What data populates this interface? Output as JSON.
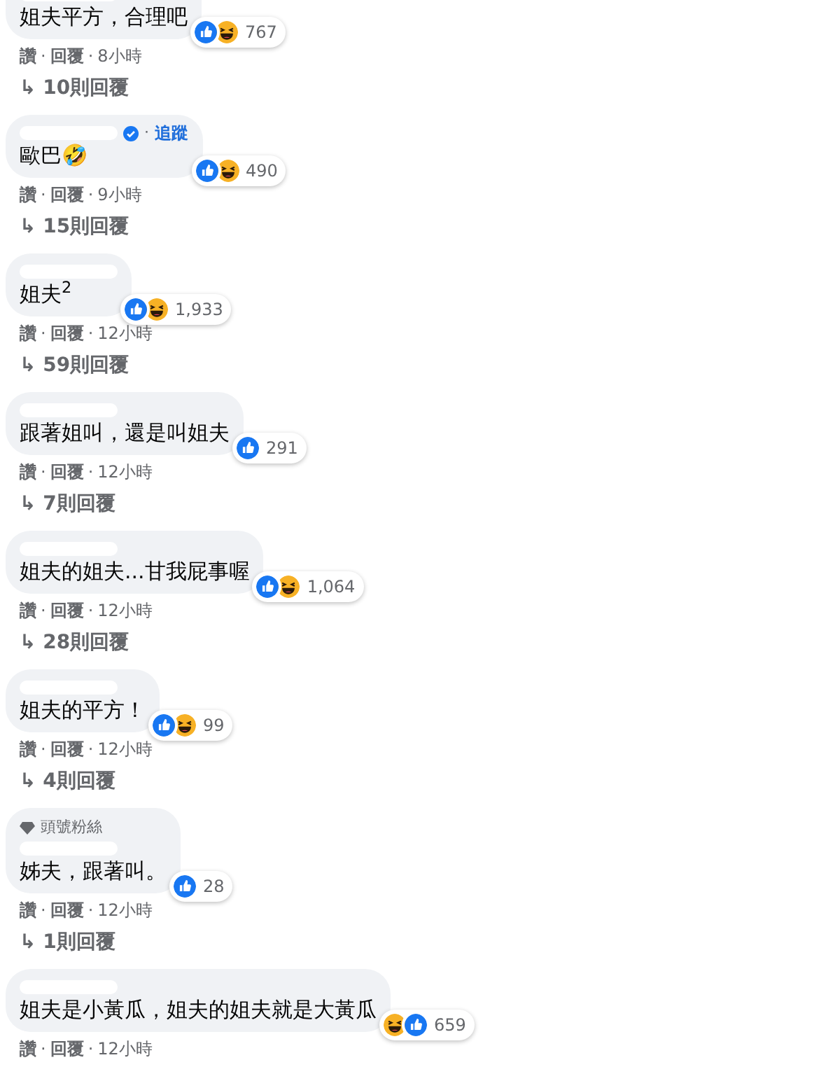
{
  "comments": [
    {
      "verified": false,
      "text": "姐夫平方，合理吧",
      "reactions": [
        {
          "kind": "like"
        },
        {
          "kind": "haha"
        }
      ],
      "count": "767",
      "actions": [
        "讚",
        "回覆",
        "8小時"
      ],
      "replies": "10則回覆"
    },
    {
      "verified": true,
      "follow": "追蹤",
      "text": "歐巴🤣",
      "reactions": [
        {
          "kind": "like"
        },
        {
          "kind": "haha"
        }
      ],
      "count": "490",
      "actions": [
        "讚",
        "回覆",
        "9小時"
      ],
      "replies": "15則回覆"
    },
    {
      "verified": false,
      "text": "姐夫$^{2}$",
      "reactions": [
        {
          "kind": "like"
        },
        {
          "kind": "haha"
        }
      ],
      "count": "1,933",
      "actions": [
        "讚",
        "回覆",
        "12小時"
      ],
      "replies": "59則回覆"
    },
    {
      "verified": false,
      "text": "跟著姐叫，還是叫姐夫",
      "reactions": [
        {
          "kind": "like"
        }
      ],
      "count": "291",
      "actions": [
        "讚",
        "回覆",
        "12小時"
      ],
      "replies": "7則回覆"
    },
    {
      "verified": false,
      "text": "姐夫的姐夫...甘我屁事喔",
      "reactions": [
        {
          "kind": "like"
        },
        {
          "kind": "haha"
        }
      ],
      "count": "1,064",
      "actions": [
        "讚",
        "回覆",
        "12小時"
      ],
      "replies": "28則回覆"
    },
    {
      "verified": false,
      "text": "姐夫的平方！",
      "reactions": [
        {
          "kind": "like"
        },
        {
          "kind": "haha"
        }
      ],
      "count": "99",
      "actions": [
        "讚",
        "回覆",
        "12小時"
      ],
      "replies": "4則回覆"
    },
    {
      "verified": false,
      "badge": "頭號粉絲",
      "text": "姊夫，跟著叫。",
      "reactions": [
        {
          "kind": "like"
        }
      ],
      "count": "28",
      "actions": [
        "讚",
        "回覆",
        "12小時"
      ],
      "replies": "1則回覆"
    },
    {
      "verified": false,
      "text": "姐夫是小黃瓜，姐夫的姐夫就是大黃瓜",
      "reactions": [
        {
          "kind": "haha"
        },
        {
          "kind": "like"
        }
      ],
      "count": "659",
      "actions": [
        "讚",
        "回覆",
        "12小時"
      ]
    }
  ],
  "separator": "·",
  "reply_arrow": "↳"
}
